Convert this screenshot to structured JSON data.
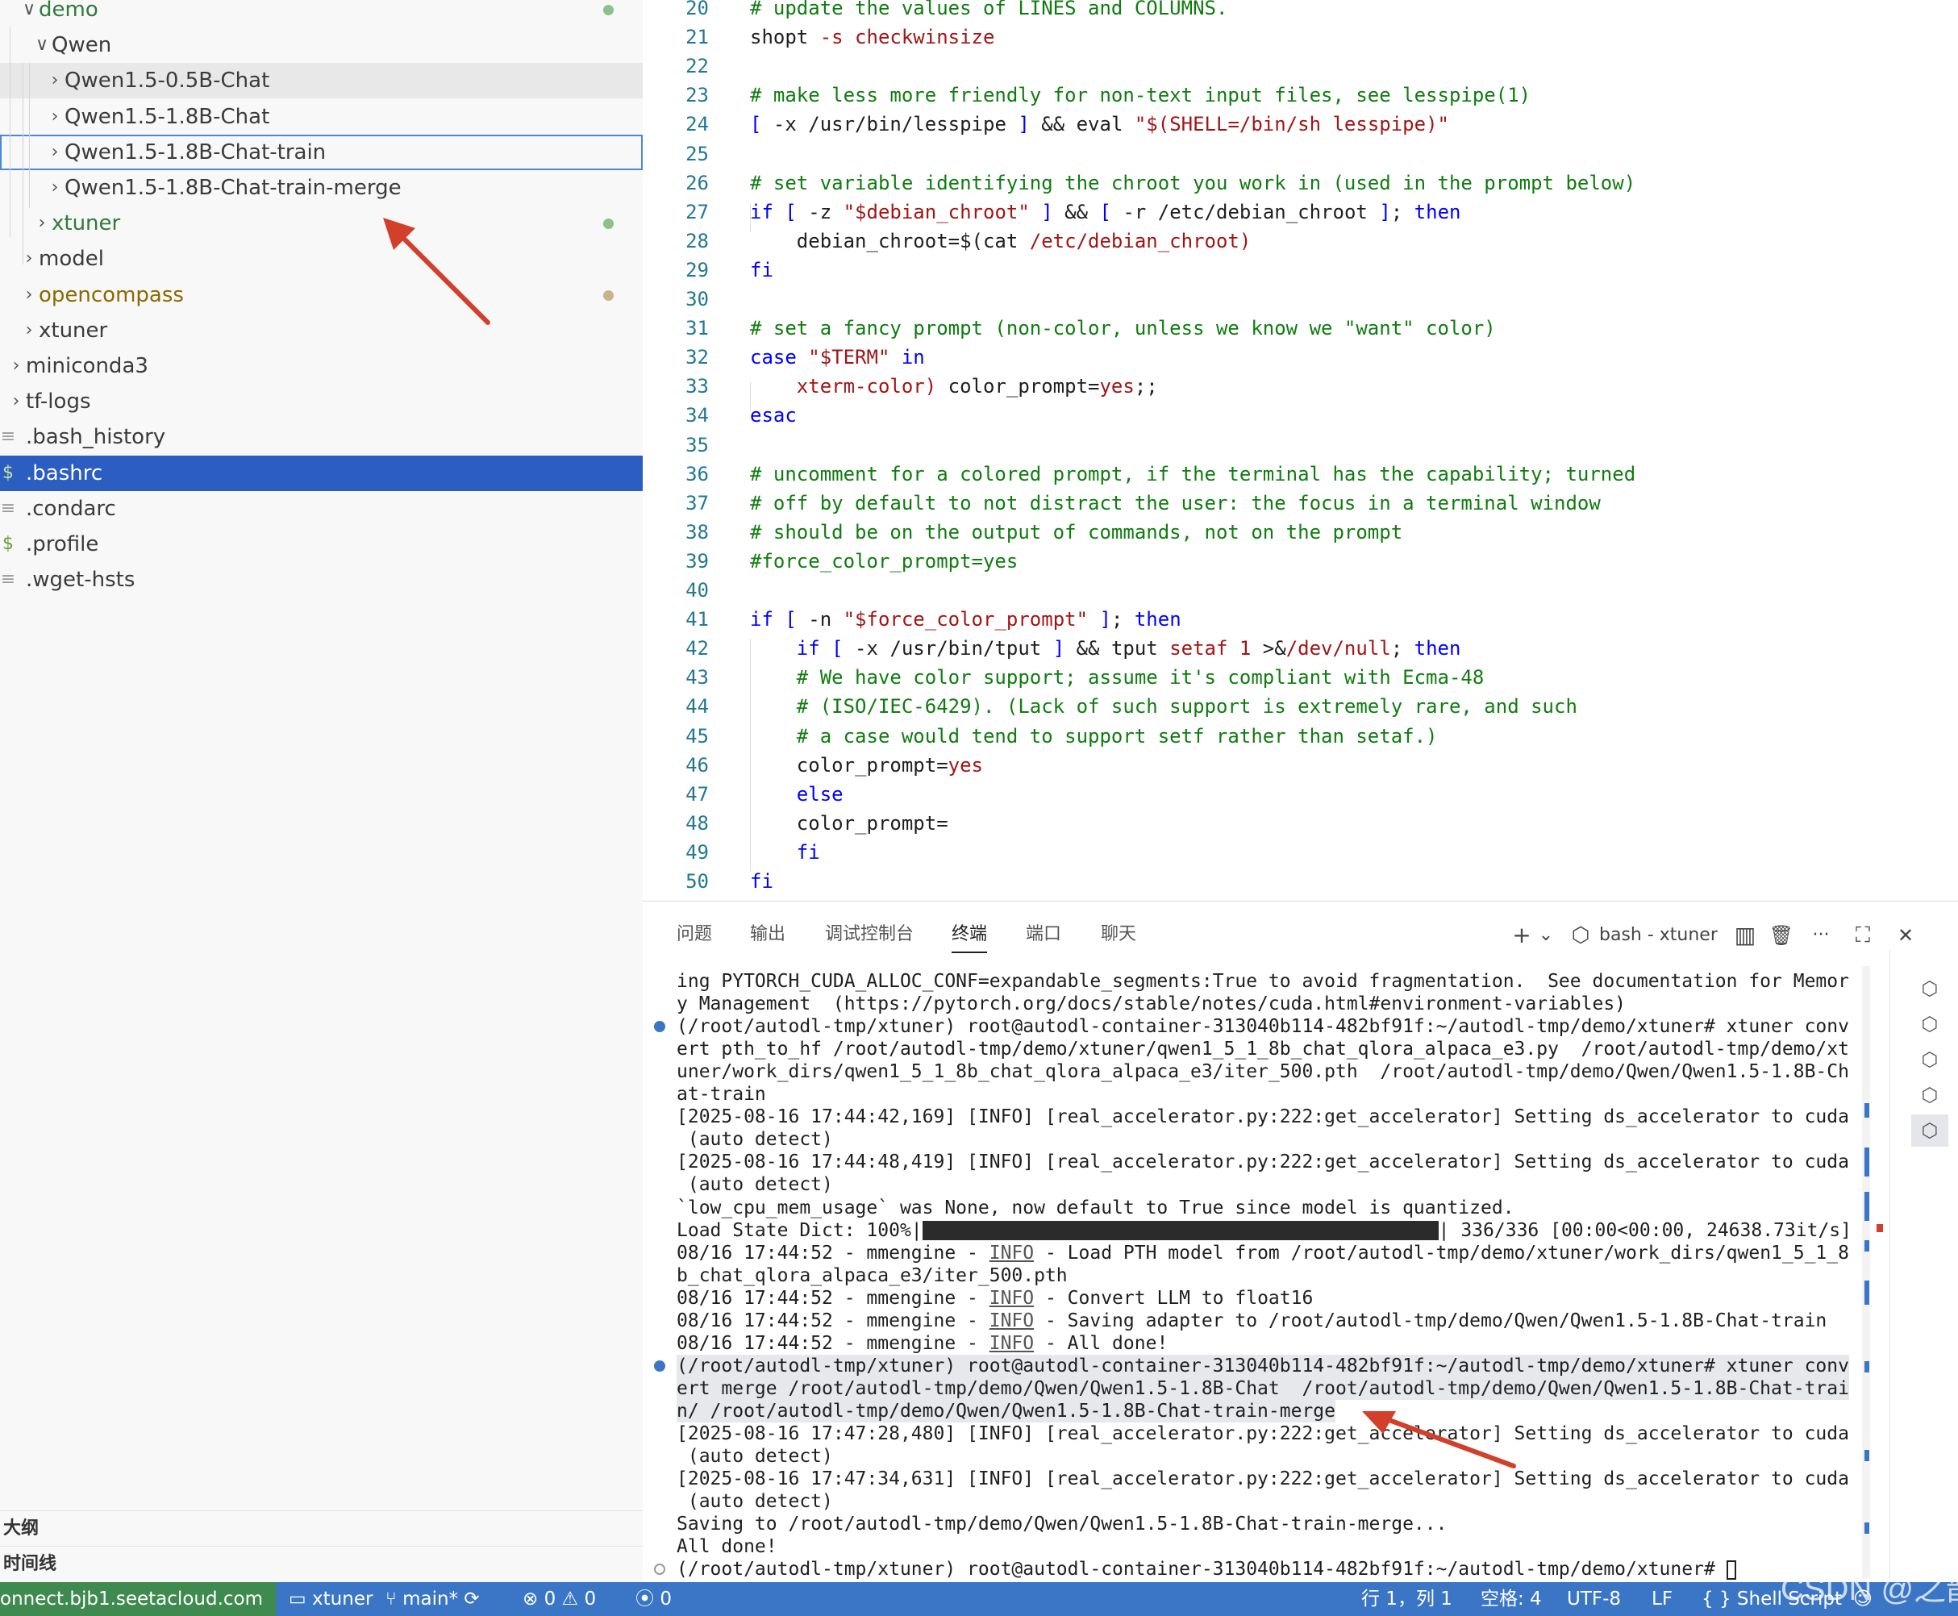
{
  "explorer": {
    "rows": [
      {
        "label": "demo",
        "kind": "folder",
        "expanded": true,
        "git": "modified"
      },
      {
        "label": "Qwen",
        "kind": "folder",
        "expanded": true
      },
      {
        "label": "Qwen1.5-0.5B-Chat",
        "kind": "folder",
        "expanded": false
      },
      {
        "label": "Qwen1.5-1.8B-Chat",
        "kind": "folder",
        "expanded": false
      },
      {
        "label": "Qwen1.5-1.8B-Chat-train",
        "kind": "folder",
        "expanded": false
      },
      {
        "label": "Qwen1.5-1.8B-Chat-train-merge",
        "kind": "folder",
        "expanded": false
      },
      {
        "label": "xtuner",
        "kind": "folder",
        "expanded": false,
        "git": "modified"
      },
      {
        "label": "model",
        "kind": "folder",
        "expanded": false
      },
      {
        "label": "opencompass",
        "kind": "folder",
        "expanded": false,
        "git": "warn"
      },
      {
        "label": "xtuner",
        "kind": "folder",
        "expanded": false
      },
      {
        "label": "miniconda3",
        "kind": "folder",
        "expanded": false
      },
      {
        "label": "tf-logs",
        "kind": "folder",
        "expanded": false
      },
      {
        "label": ".bash_history",
        "kind": "file"
      },
      {
        "label": ".bashrc",
        "kind": "shell",
        "selected": true
      },
      {
        "label": ".condarc",
        "kind": "file"
      },
      {
        "label": ".profile",
        "kind": "shell"
      },
      {
        "label": ".wget-hsts",
        "kind": "file"
      }
    ],
    "outline_label": "大纲",
    "timeline_label": "时间线",
    "file_icon_glyph": "≡",
    "shell_icon_glyph": "$",
    "chevron_open": "∨",
    "chevron_closed": "›",
    "colors": {
      "git_modified": "#2f7a3c",
      "git_warn": "#8a6a00",
      "dot_modified": "#8cc08c",
      "dot_warn": "#c9b48a",
      "selection": "#2c5dc0"
    }
  },
  "editor": {
    "lines": [
      {
        "n": "20",
        "t": [
          [
            "# update the values of LINES and COLUMNS.",
            "c"
          ]
        ]
      },
      {
        "n": "21",
        "t": [
          [
            "shopt ",
            ""
          ],
          [
            "-s checkwinsize",
            "s"
          ]
        ]
      },
      {
        "n": "22",
        "t": []
      },
      {
        "n": "23",
        "t": [
          [
            "# make less more friendly for non-text input files, see lesspipe(1)",
            "c"
          ]
        ]
      },
      {
        "n": "24",
        "t": [
          [
            "[ ",
            "k"
          ],
          [
            "-x /usr/bin/lesspipe ",
            ""
          ],
          [
            "] ",
            "k"
          ],
          [
            "&& eval ",
            ""
          ],
          [
            "\"$(SHELL=/bin/sh lesspipe)\"",
            "s"
          ]
        ]
      },
      {
        "n": "25",
        "t": []
      },
      {
        "n": "26",
        "t": [
          [
            "# set variable identifying the chroot you work in (used in the prompt below)",
            "c"
          ]
        ]
      },
      {
        "n": "27",
        "t": [
          [
            "if [ ",
            "k"
          ],
          [
            "-z ",
            ""
          ],
          [
            "\"$debian_chroot\"",
            "s"
          ],
          [
            " ] ",
            "k"
          ],
          [
            "&& ",
            ""
          ],
          [
            "[ ",
            "k"
          ],
          [
            "-r /etc/debian_chroot ",
            ""
          ],
          [
            "]",
            "k"
          ],
          [
            "; ",
            ""
          ],
          [
            "then",
            "k"
          ]
        ]
      },
      {
        "n": "28",
        "t": [
          [
            "    debian_chroot=$(cat ",
            ""
          ],
          [
            "/etc/debian_chroot)",
            "s"
          ]
        ]
      },
      {
        "n": "29",
        "t": [
          [
            "fi",
            "k"
          ]
        ]
      },
      {
        "n": "30",
        "t": []
      },
      {
        "n": "31",
        "t": [
          [
            "# set a fancy prompt (non-color, unless we know we \"want\" color)",
            "c"
          ]
        ]
      },
      {
        "n": "32",
        "t": [
          [
            "case ",
            "k"
          ],
          [
            "\"$TERM\"",
            "s"
          ],
          [
            " in",
            "k"
          ]
        ]
      },
      {
        "n": "33",
        "t": [
          [
            "    xterm-color) ",
            "s"
          ],
          [
            "color_prompt=",
            ""
          ],
          [
            "yes",
            "s"
          ],
          [
            ";;",
            ""
          ]
        ]
      },
      {
        "n": "34",
        "t": [
          [
            "esac",
            "k"
          ]
        ]
      },
      {
        "n": "35",
        "t": []
      },
      {
        "n": "36",
        "t": [
          [
            "# uncomment for a colored prompt, if the terminal has the capability; turned",
            "c"
          ]
        ]
      },
      {
        "n": "37",
        "t": [
          [
            "# off by default to not distract the user: the focus in a terminal window",
            "c"
          ]
        ]
      },
      {
        "n": "38",
        "t": [
          [
            "# should be on the output of commands, not on the prompt",
            "c"
          ]
        ]
      },
      {
        "n": "39",
        "t": [
          [
            "#force_color_prompt=yes",
            "c"
          ]
        ]
      },
      {
        "n": "40",
        "t": []
      },
      {
        "n": "41",
        "t": [
          [
            "if [ ",
            "k"
          ],
          [
            "-n ",
            ""
          ],
          [
            "\"$force_color_prompt\"",
            "s"
          ],
          [
            " ]",
            "k"
          ],
          [
            "; ",
            ""
          ],
          [
            "then",
            "k"
          ]
        ]
      },
      {
        "n": "42",
        "t": [
          [
            "    ",
            ""
          ],
          [
            "if [ ",
            "k"
          ],
          [
            "-x /usr/bin/tput ",
            ""
          ],
          [
            "] ",
            "k"
          ],
          [
            "&& tput ",
            ""
          ],
          [
            "setaf 1 ",
            "s"
          ],
          [
            ">&",
            ""
          ],
          [
            "/dev/null",
            "s"
          ],
          [
            "; ",
            ""
          ],
          [
            "then",
            "k"
          ]
        ]
      },
      {
        "n": "43",
        "t": [
          [
            "    # We have color support; assume it's compliant with Ecma-48",
            "c"
          ]
        ]
      },
      {
        "n": "44",
        "t": [
          [
            "    # (ISO/IEC-6429). (Lack of such support is extremely rare, and such",
            "c"
          ]
        ]
      },
      {
        "n": "45",
        "t": [
          [
            "    # a case would tend to support setf rather than setaf.)",
            "c"
          ]
        ]
      },
      {
        "n": "46",
        "t": [
          [
            "    color_prompt=",
            ""
          ],
          [
            "yes",
            "s"
          ]
        ]
      },
      {
        "n": "47",
        "t": [
          [
            "    ",
            ""
          ],
          [
            "else",
            "k"
          ]
        ]
      },
      {
        "n": "48",
        "t": [
          [
            "    color_prompt=",
            ""
          ]
        ]
      },
      {
        "n": "49",
        "t": [
          [
            "    ",
            ""
          ],
          [
            "fi",
            "k"
          ]
        ]
      },
      {
        "n": "50",
        "t": [
          [
            "fi",
            "k"
          ]
        ]
      }
    ]
  },
  "panel": {
    "tabs": [
      "问题",
      "输出",
      "调试控制台",
      "终端",
      "端口",
      "聊天"
    ],
    "active_tab": "终端",
    "terminal_name": "bash - xtuner",
    "icons": {
      "add": "+",
      "dropdown": "⌄",
      "split": "▥",
      "trash": "🗑",
      "more": "···",
      "maximize": "⛶",
      "close": "✕",
      "terminal": "⬡"
    },
    "terminal_lines": [
      {
        "t": "ing PYTORCH_CUDA_ALLOC_CONF=expandable_segments:True to avoid fragmentation.  See documentation for Memor"
      },
      {
        "t": "y Management  (https://pytorch.org/docs/stable/notes/cuda.html#environment-variables)"
      },
      {
        "t": "(/root/autodl-tmp/xtuner) root@autodl-container-313040b114-482bf91f:~/autodl-tmp/demo/xtuner# xtuner conv",
        "dot": "blue"
      },
      {
        "t": "ert pth_to_hf /root/autodl-tmp/demo/xtuner/qwen1_5_1_8b_chat_qlora_alpaca_e3.py  /root/autodl-tmp/demo/xt"
      },
      {
        "t": "uner/work_dirs/qwen1_5_1_8b_chat_qlora_alpaca_e3/iter_500.pth  /root/autodl-tmp/demo/Qwen/Qwen1.5-1.8B-Ch"
      },
      {
        "t": "at-train"
      },
      {
        "t": "[2025-08-16 17:44:42,169] [INFO] [real_accelerator.py:222:get_accelerator] Setting ds_accelerator to cuda"
      },
      {
        "t": " (auto detect)"
      },
      {
        "t": "[2025-08-16 17:44:48,419] [INFO] [real_accelerator.py:222:get_accelerator] Setting ds_accelerator to cuda"
      },
      {
        "t": " (auto detect)"
      },
      {
        "t": "`low_cpu_mem_usage` was None, now default to True since model is quantized."
      },
      {
        "t": "Load State Dict: 100%|",
        "progress": 1.0,
        "tail": "| 336/336 [00:00<00:00, 24638.73it/s]"
      },
      {
        "t": "08/16 17:44:52 - mmengine - ",
        "info": "INFO",
        "rest": " - Load PTH model from /root/autodl-tmp/demo/xtuner/work_dirs/qwen1_5_1_8"
      },
      {
        "t": "b_chat_qlora_alpaca_e3/iter_500.pth"
      },
      {
        "t": "08/16 17:44:52 - mmengine - ",
        "info": "INFO",
        "rest": " - Convert LLM to float16"
      },
      {
        "t": "08/16 17:44:52 - mmengine - ",
        "info": "INFO",
        "rest": " - Saving adapter to /root/autodl-tmp/demo/Qwen/Qwen1.5-1.8B-Chat-train"
      },
      {
        "t": "08/16 17:44:52 - mmengine - ",
        "info": "INFO",
        "rest": " - All done!"
      },
      {
        "t": "(/root/autodl-tmp/xtuner) root@autodl-container-313040b114-482bf91f:~/autodl-tmp/demo/xtuner# xtuner conv",
        "dot": "blue",
        "hl": true
      },
      {
        "t": "ert merge /root/autodl-tmp/demo/Qwen/Qwen1.5-1.8B-Chat  /root/autodl-tmp/demo/Qwen/Qwen1.5-1.8B-Chat-trai",
        "hl": true
      },
      {
        "t": "n/ /root/autodl-tmp/demo/Qwen/Qwen1.5-1.8B-Chat-train-merge",
        "hl": true
      },
      {
        "t": "[2025-08-16 17:47:28,480] [INFO] [real_accelerator.py:222:get_accelerator] Setting ds_accelerator to cuda"
      },
      {
        "t": " (auto detect)"
      },
      {
        "t": "[2025-08-16 17:47:34,631] [INFO] [real_accelerator.py:222:get_accelerator] Setting ds_accelerator to cuda"
      },
      {
        "t": " (auto detect)"
      },
      {
        "t": "Saving to /root/autodl-tmp/demo/Qwen/Qwen1.5-1.8B-Chat-train-merge..."
      },
      {
        "t": "All done!"
      },
      {
        "t": "(/root/autodl-tmp/xtuner) root@autodl-container-313040b114-482bf91f:~/autodl-tmp/demo/xtuner# ",
        "dot": "hollow",
        "cursor": true
      }
    ]
  },
  "statusbar": {
    "remote": "onnect.bjb1.seetacloud.com",
    "workspace": "xtuner",
    "branch": "main*",
    "sync_icon": "⟳",
    "errors": "0",
    "warnings": "0",
    "ports": "0",
    "position": "行 1，列 1",
    "spaces": "空格: 4",
    "encoding": "UTF-8",
    "eol": "LF",
    "language": "Shell Script",
    "watermark": "CSDN @之歆"
  }
}
